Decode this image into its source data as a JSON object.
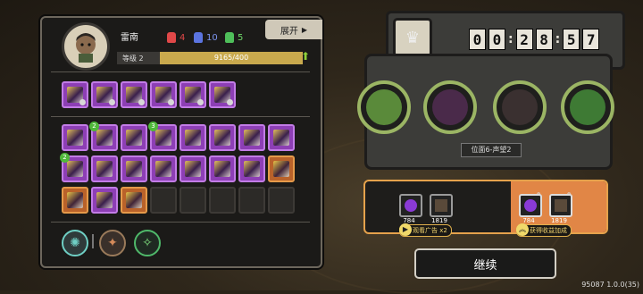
{
  "player": {
    "name": "雷南",
    "level_label": "等级 2",
    "xp_text": "9165/400",
    "xp_fill": 1.0
  },
  "resources": [
    {
      "icon": "red-mask-icon",
      "color": "#e04848",
      "value": "4"
    },
    {
      "icon": "blue-mask-icon",
      "color": "#5b74e0",
      "value": "10"
    },
    {
      "icon": "green-mask-icon",
      "color": "#4fbf5a",
      "value": "5"
    }
  ],
  "expand_label": "展开",
  "equip_row": {
    "count": 6
  },
  "skill_rows": [
    [
      {
        "c": "purple"
      },
      {
        "c": "purple",
        "badge": "2"
      },
      {
        "c": "purple"
      },
      {
        "c": "purple",
        "badge": "3"
      },
      {
        "c": "purple"
      },
      {
        "c": "purple"
      },
      {
        "c": "purple"
      },
      {
        "c": "purple"
      }
    ],
    [
      {
        "c": "purple",
        "badge": "2"
      },
      {
        "c": "purple"
      },
      {
        "c": "purple"
      },
      {
        "c": "purple"
      },
      {
        "c": "purple"
      },
      {
        "c": "purple"
      },
      {
        "c": "purple"
      },
      {
        "c": "orange"
      }
    ],
    [
      {
        "c": "orange"
      },
      {
        "c": "purple"
      },
      {
        "c": "orange"
      },
      {
        "c": "empty"
      },
      {
        "c": "empty"
      },
      {
        "c": "empty"
      },
      {
        "c": "empty"
      },
      {
        "c": "empty"
      }
    ]
  ],
  "timer": {
    "digits": [
      "0",
      "0",
      "2",
      "8",
      "5",
      "7"
    ]
  },
  "position_label": "位面6-声望2",
  "rewards": {
    "free": [
      {
        "icon": "purple-orb-icon",
        "value": "784"
      },
      {
        "icon": "dark-tablet-icon",
        "value": "1819"
      }
    ],
    "boosted": [
      {
        "icon": "purple-orb-icon",
        "value": "784"
      },
      {
        "icon": "dark-tablet-icon",
        "value": "1819"
      }
    ],
    "ad_label": "观看广告 x2",
    "bonus_label": "获得收益加成"
  },
  "continue_label": "继续",
  "version": "95087 1.0.0(35)"
}
